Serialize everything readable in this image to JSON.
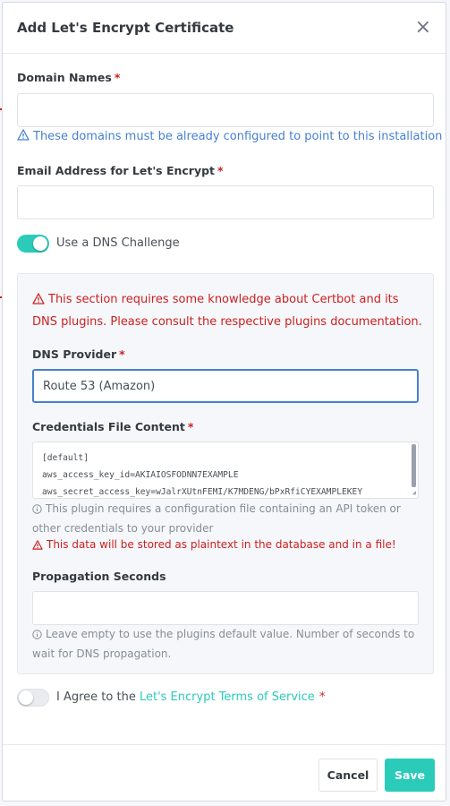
{
  "modal": {
    "title": "Add Let's Encrypt Certificate",
    "close_glyph": "×"
  },
  "domain_names": {
    "label": "Domain Names",
    "required_mark": "*",
    "value": "",
    "hint": "These domains must be already configured to point to this installation"
  },
  "email": {
    "label": "Email Address for Let's Encrypt",
    "required_mark": "*",
    "value": ""
  },
  "dns_challenge": {
    "label": "Use a DNS Challenge",
    "enabled": true
  },
  "dns_section": {
    "warning": "This section requires some knowledge about Certbot and its DNS plugins. Please consult the respective plugins documentation.",
    "provider_label": "DNS Provider",
    "provider_required": "*",
    "provider_value": "Route 53 (Amazon)",
    "credentials_label": "Credentials File Content",
    "credentials_required": "*",
    "credentials_lines": [
      "[default]",
      "aws_access_key_id=AKIAIOSFODNN7EXAMPLE",
      "aws_secret_access_key=wJalrXUtnFEMI/K7MDENG/bPxRfiCYEXAMPLEKEY"
    ],
    "credentials_info": "This plugin requires a configuration file containing an API token or other credentials to your provider",
    "credentials_warning": "This data will be stored as plaintext in the database and in a file!",
    "propagation_label": "Propagation Seconds",
    "propagation_value": "",
    "propagation_info": "Leave empty to use the plugins default value. Number of seconds to wait for DNS propagation."
  },
  "agree": {
    "enabled": false,
    "prefix": "I Agree to the",
    "link": "Let's Encrypt Terms of Service",
    "required_mark": "*"
  },
  "footer": {
    "cancel_label": "Cancel",
    "save_label": "Save"
  },
  "colors": {
    "accent": "#2bcbba",
    "danger": "#cd201f",
    "info": "#467fcf"
  }
}
